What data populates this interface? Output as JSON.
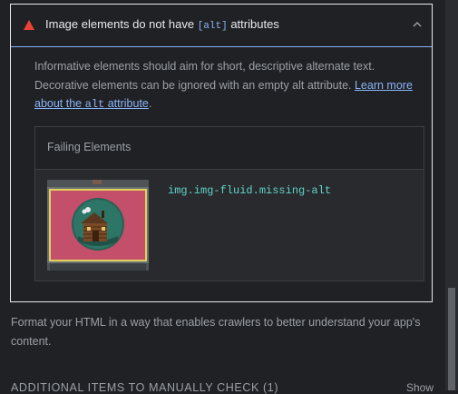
{
  "audit": {
    "title_before": "Image elements do not have",
    "title_code": "[alt]",
    "title_after": "attributes",
    "status_color": "#ea4335",
    "expanded": true
  },
  "description": {
    "text": "Informative elements should aim for short, descriptive alternate text. Decorative elements can be ignored with an empty alt attribute.",
    "link_before": "Learn more about the",
    "link_code": "alt",
    "link_after": "attribute",
    "period": "."
  },
  "failing": {
    "header": "Failing Elements",
    "items": [
      {
        "selector": "img.img-fluid.missing-alt",
        "thumbnail": "log-cabin-image"
      }
    ]
  },
  "next_description": "Format your HTML in a way that enables crawlers to better understand your app's content.",
  "manual_section": {
    "label": "ADDITIONAL ITEMS TO MANUALLY CHECK (1)",
    "toggle": "Show"
  }
}
